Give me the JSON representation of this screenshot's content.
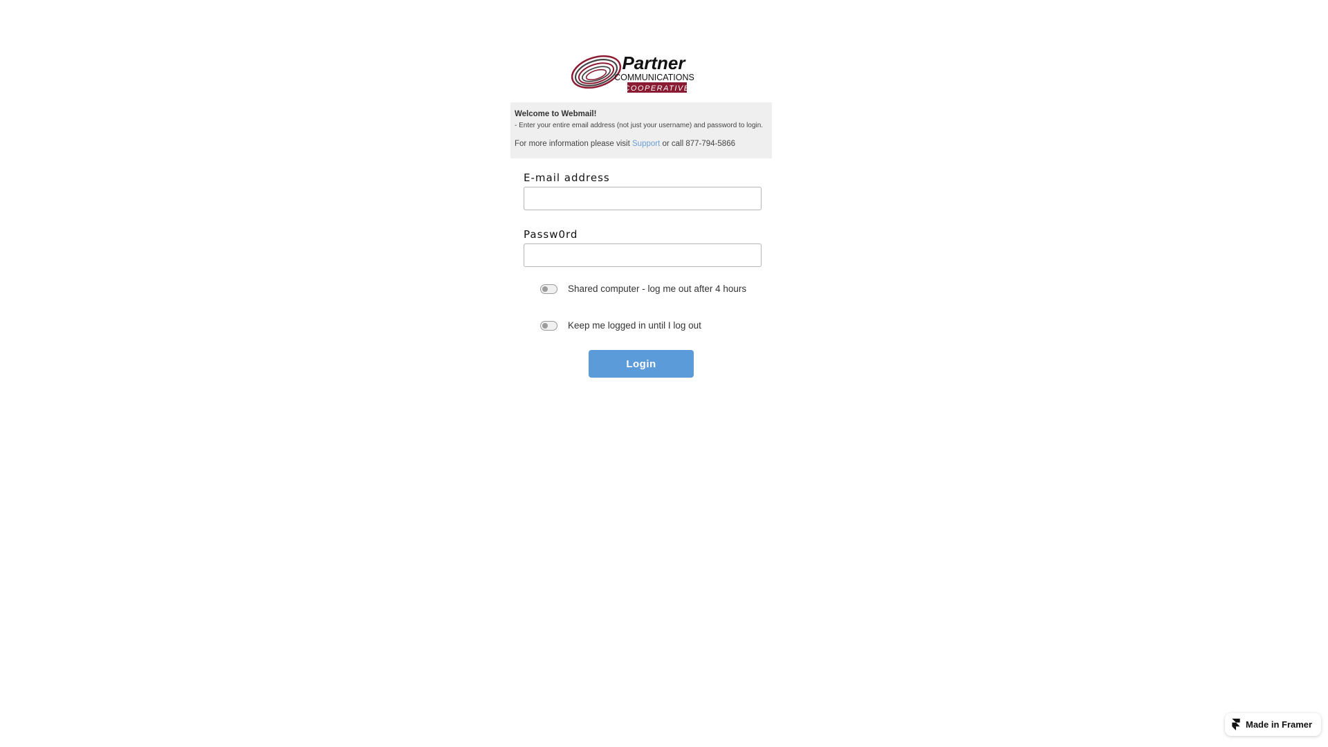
{
  "logo": {
    "brand": "Partner",
    "line2": "COMMUNICATIONS",
    "line3": "COOPERATIVE",
    "brand_color": "#8b1a33"
  },
  "info": {
    "title": "Welcome to Webmail!",
    "instruction": "- Enter your entire email address (not just your username) and password to login.",
    "more_prefix": "For more information please visit ",
    "support_link": "Support",
    "more_suffix": " or call 877-794-5866"
  },
  "form": {
    "email_label": "E-mail address",
    "email_value": "",
    "password_label": "Passw0rd",
    "password_value": "",
    "shared_toggle_label": "Shared computer - log me out after 4 hours",
    "keep_toggle_label": "Keep me logged in until I log out",
    "login_label": "Login"
  },
  "badge": {
    "label": "Made in Framer",
    "icon": "framer-icon"
  },
  "colors": {
    "accent": "#5b9bd9",
    "link": "#6a9fd6",
    "info_bg": "#efefef"
  }
}
